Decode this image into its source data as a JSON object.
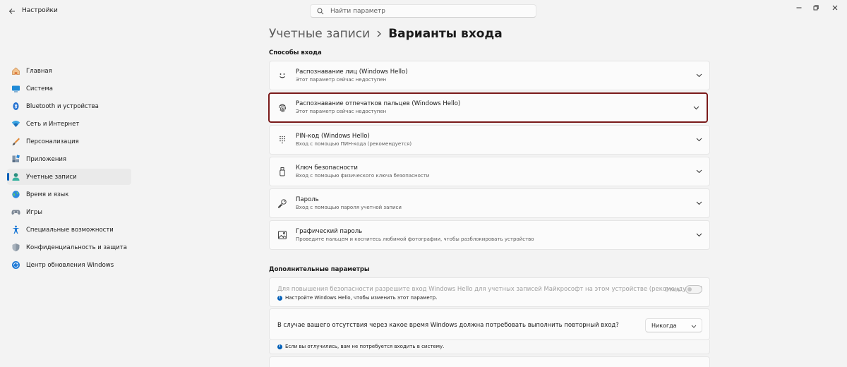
{
  "app": {
    "title": "Настройки"
  },
  "search": {
    "placeholder": "Найти параметр"
  },
  "sidebar": {
    "items": [
      {
        "label": "Главная",
        "icon": "home-icon"
      },
      {
        "label": "Система",
        "icon": "display-icon"
      },
      {
        "label": "Bluetooth и устройства",
        "icon": "bluetooth-icon"
      },
      {
        "label": "Сеть и Интернет",
        "icon": "wifi-icon"
      },
      {
        "label": "Персонализация",
        "icon": "brush-icon"
      },
      {
        "label": "Приложения",
        "icon": "apps-icon"
      },
      {
        "label": "Учетные записи",
        "icon": "account-icon",
        "active": true
      },
      {
        "label": "Время и язык",
        "icon": "globe-icon"
      },
      {
        "label": "Игры",
        "icon": "gamepad-icon"
      },
      {
        "label": "Специальные возможности",
        "icon": "accessibility-icon"
      },
      {
        "label": "Конфиденциальность и защита",
        "icon": "shield-icon"
      },
      {
        "label": "Центр обновления Windows",
        "icon": "update-icon"
      }
    ]
  },
  "breadcrumb": {
    "parent": "Учетные записи",
    "current": "Варианты входа"
  },
  "sign_in": {
    "section_title": "Способы входа",
    "options": [
      {
        "title": "Распознавание лиц (Windows Hello)",
        "subtitle": "Этот параметр сейчас недоступен",
        "icon": "face-icon"
      },
      {
        "title": "Распознавание отпечатков пальцев (Windows Hello)",
        "subtitle": "Этот параметр сейчас недоступен",
        "icon": "fingerprint-icon",
        "selected": true
      },
      {
        "title": "PIN-код (Windows Hello)",
        "subtitle": "Вход с помощью ПИН-кода (рекомендуется)",
        "icon": "pin-keypad-icon"
      },
      {
        "title": "Ключ безопасности",
        "subtitle": "Вход с помощью физического ключа безопасности",
        "icon": "usb-key-icon"
      },
      {
        "title": "Пароль",
        "subtitle": "Вход с помощью пароля учетной записи",
        "icon": "key-icon"
      },
      {
        "title": "Графический пароль",
        "subtitle": "Проведите пальцем и коснитесь любимой фотографии, чтобы разблокировать устройство",
        "icon": "picture-icon"
      }
    ]
  },
  "additional": {
    "section_title": "Дополнительные параметры",
    "hello_only": {
      "text": "Для повышения безопасности разрешите вход Windows Hello для учетных записей Майкрософт на этом устройстве (рекомендуется)",
      "info": "Настройте Windows Hello, чтобы изменить этот параметр.",
      "toggle_label": "Откл.",
      "toggle_on": false
    },
    "require_signin": {
      "text": "В случае вашего отсутствия через какое время Windows должна потребовать выполнить повторный вход?",
      "selected": "Никогда",
      "info": "Если вы отлучились, вам не потребуется входить в систему."
    }
  },
  "colors": {
    "accent": "#005fb8",
    "selection_border": "#7a1a1a",
    "background": "#f3f3f3",
    "card": "#fbfbfb"
  }
}
